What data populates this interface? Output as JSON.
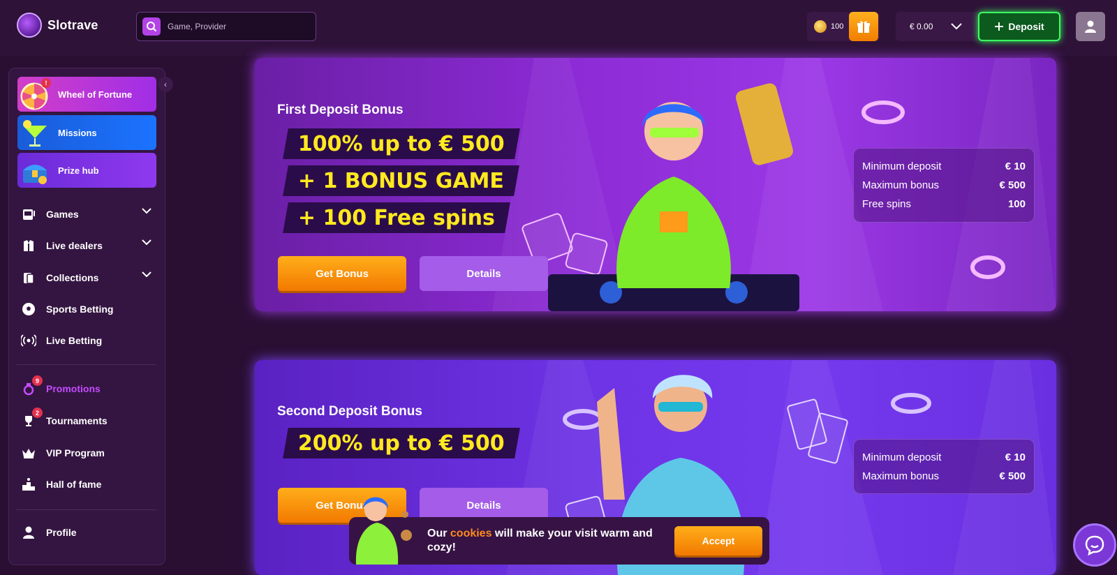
{
  "header": {
    "logo_text": "Slotrave",
    "search_placeholder": "Game, Provider",
    "coins": "100",
    "balance": "€ 0.00",
    "deposit_label": "Deposit"
  },
  "sidebar": {
    "features": [
      {
        "label": "Wheel of Fortune",
        "badge": "!"
      },
      {
        "label": "Missions"
      },
      {
        "label": "Prize hub"
      }
    ],
    "nav": [
      {
        "label": "Games",
        "icon": "slot-machine-icon",
        "expandable": true
      },
      {
        "label": "Live dealers",
        "icon": "dealer-icon",
        "expandable": true
      },
      {
        "label": "Collections",
        "icon": "cards-icon",
        "expandable": true
      },
      {
        "label": "Sports Betting",
        "icon": "soccer-ball-icon"
      },
      {
        "label": "Live Betting",
        "icon": "broadcast-icon"
      },
      {
        "label": "Promotions",
        "icon": "promotions-icon",
        "badge": "9",
        "active": true
      },
      {
        "label": "Tournaments",
        "icon": "trophy-icon",
        "badge": "2"
      },
      {
        "label": "VIP Program",
        "icon": "crown-icon"
      },
      {
        "label": "Hall of fame",
        "icon": "podium-icon"
      },
      {
        "label": "Profile",
        "icon": "user-icon"
      }
    ]
  },
  "banners": [
    {
      "title": "First Deposit Bonus",
      "headlines": [
        "100% up to € 500",
        "+ 1 BONUS GAME",
        "+ 100 Free spins"
      ],
      "get_bonus": "Get Bonus",
      "details": "Details",
      "info": [
        {
          "label": "Minimum deposit",
          "value": "€ 10"
        },
        {
          "label": "Maximum bonus",
          "value": "€ 500"
        },
        {
          "label": "Free spins",
          "value": "100"
        }
      ]
    },
    {
      "title": "Second Deposit Bonus",
      "headlines": [
        "200% up to € 500"
      ],
      "get_bonus": "Get Bonus",
      "details": "Details",
      "info": [
        {
          "label": "Minimum deposit",
          "value": "€ 10"
        },
        {
          "label": "Maximum bonus",
          "value": "€ 500"
        }
      ]
    }
  ],
  "cookie": {
    "text_before": "Our ",
    "highlight": "cookies",
    "text_after": " will make your visit warm and cozy!",
    "accept_label": "Accept"
  },
  "colors": {
    "background": "#2a0f33",
    "accent_orange": "#f27900",
    "deposit_green": "#3cff63",
    "headline_yellow": "#ffe91f",
    "active_purple": "#c54bff"
  }
}
